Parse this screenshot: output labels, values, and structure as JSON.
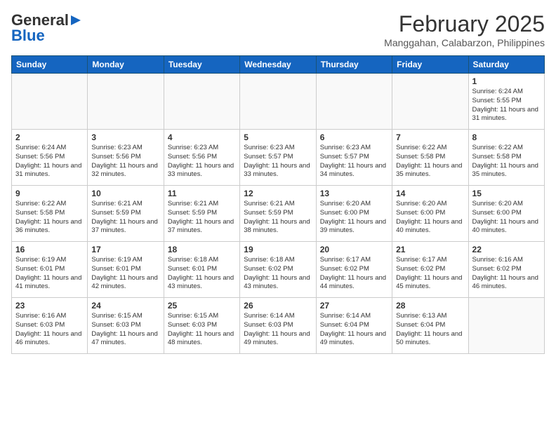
{
  "header": {
    "logo_general": "General",
    "logo_blue": "Blue",
    "month_title": "February 2025",
    "location": "Manggahan, Calabarzon, Philippines"
  },
  "days_of_week": [
    "Sunday",
    "Monday",
    "Tuesday",
    "Wednesday",
    "Thursday",
    "Friday",
    "Saturday"
  ],
  "weeks": [
    [
      {
        "day": "",
        "info": ""
      },
      {
        "day": "",
        "info": ""
      },
      {
        "day": "",
        "info": ""
      },
      {
        "day": "",
        "info": ""
      },
      {
        "day": "",
        "info": ""
      },
      {
        "day": "",
        "info": ""
      },
      {
        "day": "1",
        "info": "Sunrise: 6:24 AM\nSunset: 5:55 PM\nDaylight: 11 hours and 31 minutes."
      }
    ],
    [
      {
        "day": "2",
        "info": "Sunrise: 6:24 AM\nSunset: 5:56 PM\nDaylight: 11 hours and 31 minutes."
      },
      {
        "day": "3",
        "info": "Sunrise: 6:23 AM\nSunset: 5:56 PM\nDaylight: 11 hours and 32 minutes."
      },
      {
        "day": "4",
        "info": "Sunrise: 6:23 AM\nSunset: 5:56 PM\nDaylight: 11 hours and 33 minutes."
      },
      {
        "day": "5",
        "info": "Sunrise: 6:23 AM\nSunset: 5:57 PM\nDaylight: 11 hours and 33 minutes."
      },
      {
        "day": "6",
        "info": "Sunrise: 6:23 AM\nSunset: 5:57 PM\nDaylight: 11 hours and 34 minutes."
      },
      {
        "day": "7",
        "info": "Sunrise: 6:22 AM\nSunset: 5:58 PM\nDaylight: 11 hours and 35 minutes."
      },
      {
        "day": "8",
        "info": "Sunrise: 6:22 AM\nSunset: 5:58 PM\nDaylight: 11 hours and 35 minutes."
      }
    ],
    [
      {
        "day": "9",
        "info": "Sunrise: 6:22 AM\nSunset: 5:58 PM\nDaylight: 11 hours and 36 minutes."
      },
      {
        "day": "10",
        "info": "Sunrise: 6:21 AM\nSunset: 5:59 PM\nDaylight: 11 hours and 37 minutes."
      },
      {
        "day": "11",
        "info": "Sunrise: 6:21 AM\nSunset: 5:59 PM\nDaylight: 11 hours and 37 minutes."
      },
      {
        "day": "12",
        "info": "Sunrise: 6:21 AM\nSunset: 5:59 PM\nDaylight: 11 hours and 38 minutes."
      },
      {
        "day": "13",
        "info": "Sunrise: 6:20 AM\nSunset: 6:00 PM\nDaylight: 11 hours and 39 minutes."
      },
      {
        "day": "14",
        "info": "Sunrise: 6:20 AM\nSunset: 6:00 PM\nDaylight: 11 hours and 40 minutes."
      },
      {
        "day": "15",
        "info": "Sunrise: 6:20 AM\nSunset: 6:00 PM\nDaylight: 11 hours and 40 minutes."
      }
    ],
    [
      {
        "day": "16",
        "info": "Sunrise: 6:19 AM\nSunset: 6:01 PM\nDaylight: 11 hours and 41 minutes."
      },
      {
        "day": "17",
        "info": "Sunrise: 6:19 AM\nSunset: 6:01 PM\nDaylight: 11 hours and 42 minutes."
      },
      {
        "day": "18",
        "info": "Sunrise: 6:18 AM\nSunset: 6:01 PM\nDaylight: 11 hours and 43 minutes."
      },
      {
        "day": "19",
        "info": "Sunrise: 6:18 AM\nSunset: 6:02 PM\nDaylight: 11 hours and 43 minutes."
      },
      {
        "day": "20",
        "info": "Sunrise: 6:17 AM\nSunset: 6:02 PM\nDaylight: 11 hours and 44 minutes."
      },
      {
        "day": "21",
        "info": "Sunrise: 6:17 AM\nSunset: 6:02 PM\nDaylight: 11 hours and 45 minutes."
      },
      {
        "day": "22",
        "info": "Sunrise: 6:16 AM\nSunset: 6:02 PM\nDaylight: 11 hours and 46 minutes."
      }
    ],
    [
      {
        "day": "23",
        "info": "Sunrise: 6:16 AM\nSunset: 6:03 PM\nDaylight: 11 hours and 46 minutes."
      },
      {
        "day": "24",
        "info": "Sunrise: 6:15 AM\nSunset: 6:03 PM\nDaylight: 11 hours and 47 minutes."
      },
      {
        "day": "25",
        "info": "Sunrise: 6:15 AM\nSunset: 6:03 PM\nDaylight: 11 hours and 48 minutes."
      },
      {
        "day": "26",
        "info": "Sunrise: 6:14 AM\nSunset: 6:03 PM\nDaylight: 11 hours and 49 minutes."
      },
      {
        "day": "27",
        "info": "Sunrise: 6:14 AM\nSunset: 6:04 PM\nDaylight: 11 hours and 49 minutes."
      },
      {
        "day": "28",
        "info": "Sunrise: 6:13 AM\nSunset: 6:04 PM\nDaylight: 11 hours and 50 minutes."
      },
      {
        "day": "",
        "info": ""
      }
    ]
  ]
}
